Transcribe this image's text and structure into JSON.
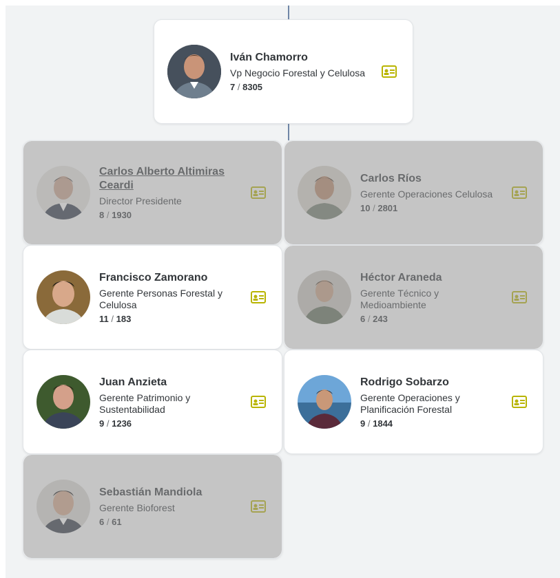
{
  "accent_icon_color": "#b8b400",
  "overlay_color": "#969696",
  "cards": [
    {
      "id": "ivan",
      "name": "Iván Chamorro",
      "title": "Vp Negocio Forestal y Celulosa",
      "direct": "7",
      "sep": "/",
      "total": "8305",
      "dimmed": false
    },
    {
      "id": "carlos-altimiras",
      "name": "Carlos Alberto Altimiras Ceardi",
      "title": "Director Presidente",
      "direct": "8",
      "sep": "/",
      "total": "1930",
      "dimmed": true
    },
    {
      "id": "carlos-rios",
      "name": "Carlos Ríos",
      "title": "Gerente Operaciones Celulosa",
      "direct": "10",
      "sep": "/",
      "total": "2801",
      "dimmed": true
    },
    {
      "id": "francisco",
      "name": "Francisco Zamorano",
      "title": "Gerente Personas Forestal y Celulosa",
      "direct": "11",
      "sep": "/",
      "total": "183",
      "dimmed": false
    },
    {
      "id": "hector",
      "name": "Héctor Araneda",
      "title": "Gerente Técnico y Medioambiente",
      "direct": "6",
      "sep": "/",
      "total": "243",
      "dimmed": true
    },
    {
      "id": "juan",
      "name": "Juan Anzieta",
      "title": "Gerente Patrimonio y Sustentabilidad",
      "direct": "9",
      "sep": "/",
      "total": "1236",
      "dimmed": false
    },
    {
      "id": "rodrigo",
      "name": "Rodrigo Sobarzo",
      "title": "Gerente Operaciones y Planificación Forestal",
      "direct": "9",
      "sep": "/",
      "total": "1844",
      "dimmed": false
    },
    {
      "id": "sebastian",
      "name": "Sebastián Mandiola",
      "title": "Gerente Bioforest",
      "direct": "6",
      "sep": "/",
      "total": "61",
      "dimmed": true
    }
  ]
}
